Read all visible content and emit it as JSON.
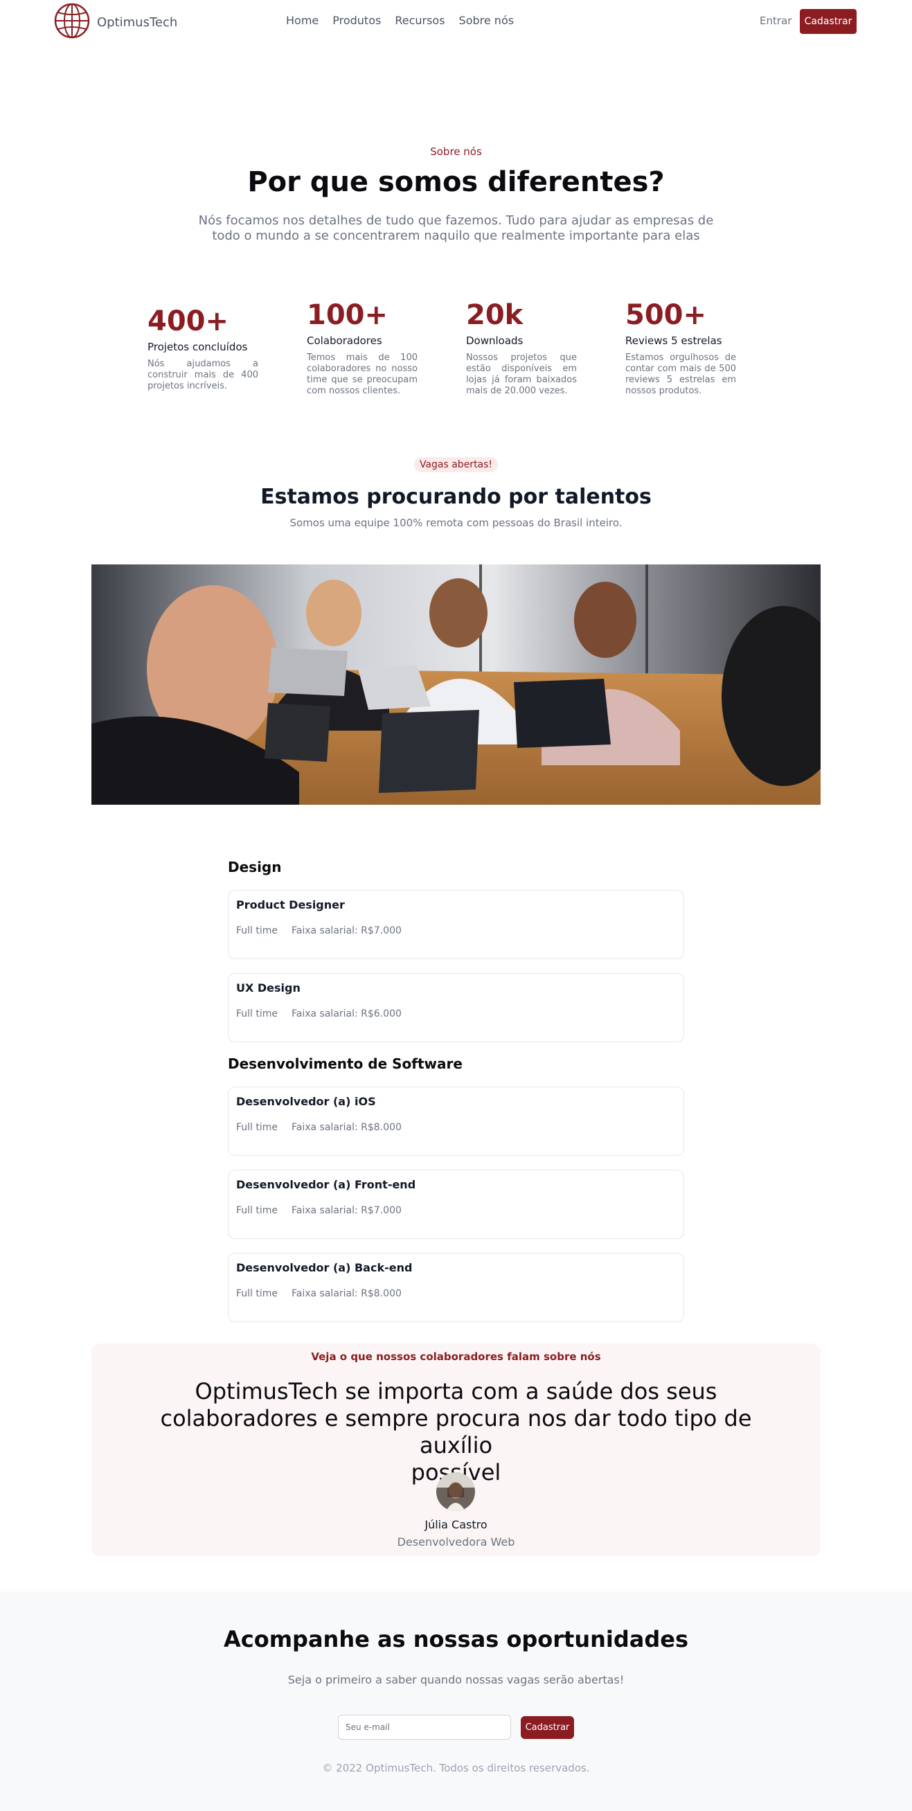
{
  "colors": {
    "accent": "#8b1d22",
    "accent_light": "#fbeaea",
    "muted_text": "#6b7280",
    "footer_bg": "#f8f9fb",
    "testimonial_bg": "#fbf6f5"
  },
  "nav": {
    "logo_icon": "globe-icon",
    "brand": "OptimusTech",
    "links": [
      "Home",
      "Produtos",
      "Recursos",
      "Sobre nós"
    ],
    "login": "Entrar",
    "signup": "Cadastrar"
  },
  "hero": {
    "eyebrow": "Sobre nós",
    "title": "Por que somos diferentes?",
    "description_lines": [
      "Nós focamos nos detalhes de tudo que fazemos. Tudo para ajudar as empresas de",
      "todo o mundo a se concentrarem naquilo que realmente importante para elas"
    ]
  },
  "stats": [
    {
      "value": "400+",
      "label": "Projetos concluídos",
      "description": "Nós ajudamos a construir mais de 400 projetos incríveis."
    },
    {
      "value": "100+",
      "label": "Colaboradores",
      "description": "Temos mais de 100 colaboradores no nosso time que se preocupam com nossos clientes."
    },
    {
      "value": "20k",
      "label": "Downloads",
      "description": "Nossos projetos que estão disponíveis em lojas já foram baixados mais de 20.000 vezes."
    },
    {
      "value": "500+",
      "label": "Reviews 5 estrelas",
      "description": "Estamos orgulhosos de contar com mais de 500 reviews 5 estrelas em nossos produtos."
    }
  ],
  "careers": {
    "badge": "Vagas abertas!",
    "title": "Estamos procurando por talentos",
    "subtitle": "Somos uma equipe 100% remota com pessoas do Brasil inteiro."
  },
  "job_categories": [
    {
      "name": "Design",
      "jobs": [
        {
          "title": "Product Designer",
          "type": "Full time",
          "salary": "Faixa salarial: R$7.000"
        },
        {
          "title": "UX Design",
          "type": "Full time",
          "salary": "Faixa salarial: R$6.000"
        }
      ]
    },
    {
      "name": "Desenvolvimento de Software",
      "jobs": [
        {
          "title": "Desenvolvedor (a) iOS",
          "type": "Full time",
          "salary": "Faixa salarial: R$8.000"
        },
        {
          "title": "Desenvolvedor (a) Front-end",
          "type": "Full time",
          "salary": "Faixa salarial: R$7.000"
        },
        {
          "title": "Desenvolvedor (a) Back-end",
          "type": "Full time",
          "salary": "Faixa salarial: R$8.000"
        }
      ]
    }
  ],
  "testimonial": {
    "eyebrow": "Veja o que nossos colaboradores falam sobre nós",
    "quote_lines": [
      "OptimusTech se importa com a saúde dos seus",
      "colaboradores e sempre procura nos dar todo tipo de auxílio",
      "possível"
    ],
    "name": "Júlia Castro",
    "role": "Desenvolvedora Web"
  },
  "newsletter": {
    "title": "Acompanhe as nossas oportunidades",
    "subtitle": "Seja o primeiro a saber quando nossas vagas serão abertas!",
    "email_placeholder": "Seu e-mail",
    "email_value": "",
    "button": "Cadastrar",
    "copyright": "© 2022 OptimusTech. Todos os direitos reservados."
  }
}
